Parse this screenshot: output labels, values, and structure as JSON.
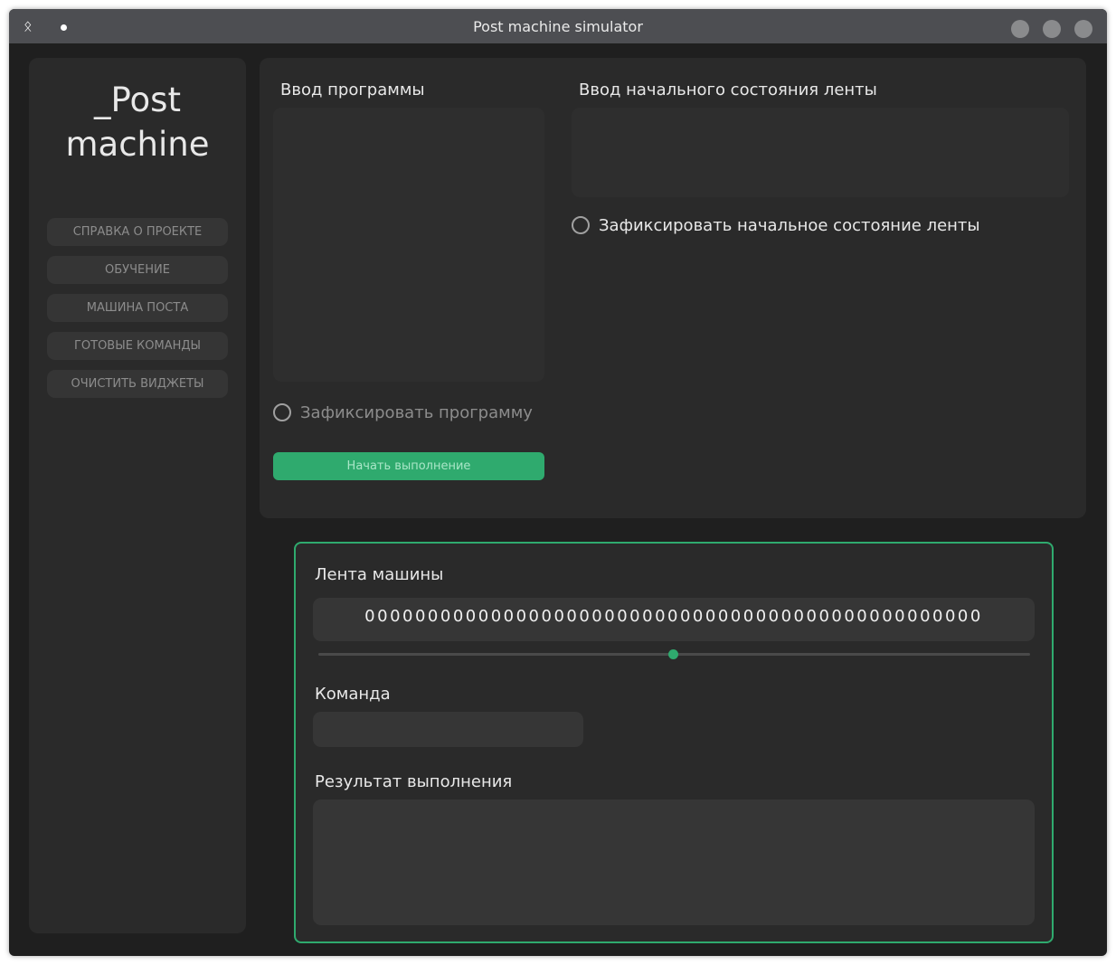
{
  "window": {
    "title": "Post machine simulator",
    "app_icon": "ᛟ"
  },
  "sidebar": {
    "logo_line1": "_Post",
    "logo_line2": "machine",
    "buttons": [
      "СПРАВКА О ПРОЕКТЕ",
      "ОБУЧЕНИЕ",
      "МАШИНА ПОСТА",
      "ГОТОВЫЕ КОМАНДЫ",
      "ОЧИСТИТЬ ВИДЖЕТЫ"
    ]
  },
  "program": {
    "label": "Ввод программы",
    "value": "",
    "fix_label": "Зафиксировать программу",
    "fix_checked": false,
    "start_label": "Начать выполнение"
  },
  "tape_input": {
    "label": "Ввод начального состояния ленты",
    "value": "",
    "fix_label": "Зафиксировать начальное состояние ленты",
    "fix_checked": false
  },
  "machine": {
    "tape_label": "Лента машины",
    "tape_value": "0000000000000000000000000000000000000000000000000",
    "slider_position": 0.5,
    "command_label": "Команда",
    "command_value": "",
    "result_label": "Результат выполнения",
    "result_value": ""
  },
  "colors": {
    "accent": "#2faa6e",
    "background": "#1f1f1f",
    "panel": "#2a2a2a"
  }
}
